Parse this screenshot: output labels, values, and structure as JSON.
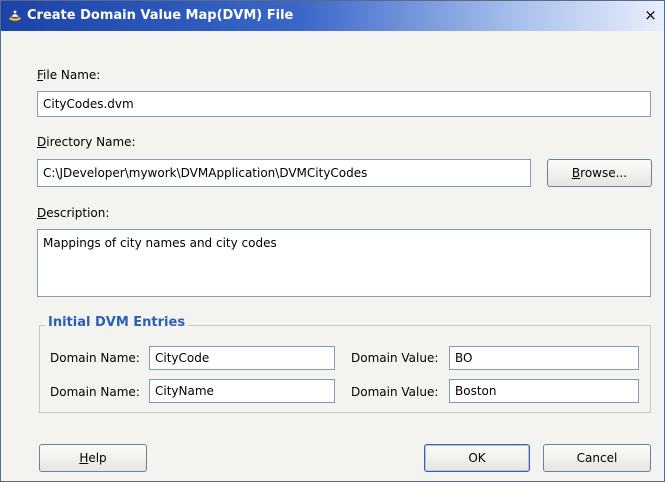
{
  "window": {
    "title": "Create Domain Value Map(DVM) File",
    "close_glyph": "×",
    "icon": "jdeveloper-app-icon"
  },
  "form": {
    "file_name": {
      "label_mnemonic": "F",
      "label_rest": "ile Name:",
      "value": "CityCodes.dvm"
    },
    "directory": {
      "label_mnemonic": "D",
      "label_rest": "irectory Name:",
      "value": "C:\\JDeveloper\\mywork\\DVMApplication\\DVMCityCodes"
    },
    "browse_button": {
      "mnemonic": "B",
      "rest": "rowse..."
    },
    "description": {
      "label_mnemonic": "D",
      "label_rest": "escription:",
      "value": "Mappings of city names and city codes"
    }
  },
  "entries": {
    "group_title": "Initial DVM Entries",
    "rows": [
      {
        "name_label": "Domain Name:",
        "name_value": "CityCode",
        "value_label": "Domain Value:",
        "value_value": "BO"
      },
      {
        "name_label": "Domain Name:",
        "name_value": "CityName",
        "value_label": "Domain Value:",
        "value_value": "Boston"
      }
    ]
  },
  "buttons": {
    "help": {
      "mnemonic": "H",
      "rest": "elp"
    },
    "ok": "OK",
    "cancel": "Cancel"
  },
  "colors": {
    "title_gradient_start": "#1b43a8",
    "group_title": "#2a5fb5",
    "dialog_bg": "#f3f3ef"
  }
}
